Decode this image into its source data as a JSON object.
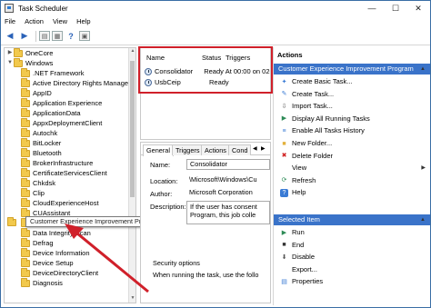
{
  "window": {
    "title": "Task Scheduler",
    "minimize": "—",
    "maximize": "☐",
    "close": "✕"
  },
  "menu": [
    "File",
    "Action",
    "View",
    "Help"
  ],
  "tree": {
    "items": [
      {
        "label": "OneCore",
        "indent": 0,
        "expanded": false
      },
      {
        "label": "Windows",
        "indent": 0,
        "expanded": true
      },
      {
        "label": ".NET Framework",
        "indent": 1
      },
      {
        "label": "Active Directory Rights Manageme",
        "indent": 1
      },
      {
        "label": "AppID",
        "indent": 1
      },
      {
        "label": "Application Experience",
        "indent": 1
      },
      {
        "label": "ApplicationData",
        "indent": 1
      },
      {
        "label": "AppxDeploymentClient",
        "indent": 1
      },
      {
        "label": "Autochk",
        "indent": 1
      },
      {
        "label": "BitLocker",
        "indent": 1
      },
      {
        "label": "Bluetooth",
        "indent": 1
      },
      {
        "label": "BrokerInfrastructure",
        "indent": 1
      },
      {
        "label": "CertificateServicesClient",
        "indent": 1
      },
      {
        "label": "Chkdsk",
        "indent": 1
      },
      {
        "label": "Clip",
        "indent": 1
      },
      {
        "label": "CloudExperienceHost",
        "indent": 1
      },
      {
        "label": "CUAssistant",
        "indent": 1
      },
      {
        "label": "",
        "indent": 1
      },
      {
        "label": "Data Integrity Scan",
        "indent": 1
      },
      {
        "label": "Defrag",
        "indent": 1
      },
      {
        "label": "Device Information",
        "indent": 1
      },
      {
        "label": "Device Setup",
        "indent": 1
      },
      {
        "label": "DeviceDirectoryClient",
        "indent": 1
      },
      {
        "label": "Diagnosis",
        "indent": 1
      }
    ],
    "tooltip": "Customer Experience Improvement Program"
  },
  "tasks": {
    "columns": {
      "name": "Name",
      "status": "Status",
      "triggers": "Triggers"
    },
    "rows": [
      {
        "name": "Consolidator",
        "status": "Ready",
        "triggers": "At 00:00 on 02-"
      },
      {
        "name": "UsbCeip",
        "status": "Ready",
        "triggers": ""
      }
    ]
  },
  "general": {
    "tabs": [
      "General",
      "Triggers",
      "Actions",
      "Cond"
    ],
    "name_label": "Name:",
    "name_value": "Consolidator",
    "location_label": "Location:",
    "location_value": "\\Microsoft\\Windows\\Cu",
    "author_label": "Author:",
    "author_value": "Microsoft Corporation",
    "description_label": "Description:",
    "description_value": "If the user has consent Program, this job colle",
    "security_title": "Security options",
    "security_text": "When running the task, use the follo"
  },
  "actions": {
    "header": "Actions",
    "selected_folder": "Customer Experience Improvement Program",
    "folder_items": [
      {
        "label": "Create Basic Task...",
        "icon": "create-basic-task-icon"
      },
      {
        "label": "Create Task...",
        "icon": "create-task-icon"
      },
      {
        "label": "Import Task...",
        "icon": "import-icon"
      },
      {
        "label": "Display All Running Tasks",
        "icon": "running-tasks-icon"
      },
      {
        "label": "Enable All Tasks History",
        "icon": "history-icon"
      },
      {
        "label": "New Folder...",
        "icon": "new-folder-icon"
      },
      {
        "label": "Delete Folder",
        "icon": "delete-folder-icon"
      },
      {
        "label": "View",
        "icon": "view-icon"
      },
      {
        "label": "Refresh",
        "icon": "refresh-icon"
      },
      {
        "label": "Help",
        "icon": "help-icon"
      }
    ],
    "selected_item": "Selected Item",
    "item_items": [
      {
        "label": "Run",
        "icon": "run-icon"
      },
      {
        "label": "End",
        "icon": "end-icon"
      },
      {
        "label": "Disable",
        "icon": "disable-icon"
      },
      {
        "label": "Export...",
        "icon": "export-icon"
      },
      {
        "label": "Properties",
        "icon": "properties-icon"
      }
    ]
  },
  "colors": {
    "selection": "#3a73c9",
    "highlight_red": "#d0202a",
    "folder": "#f2c94c"
  }
}
